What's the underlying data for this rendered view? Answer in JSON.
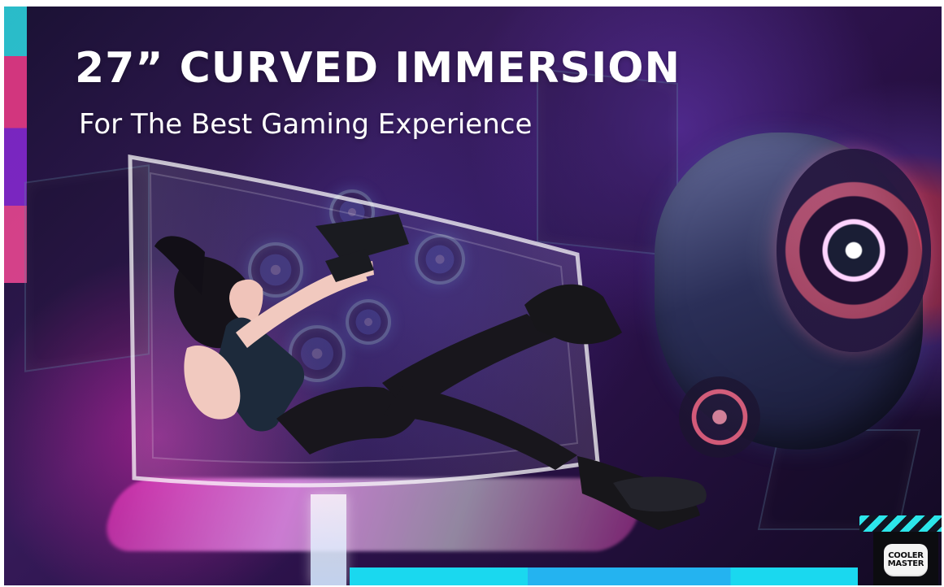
{
  "headline": "27” CURVED IMMERSION",
  "subheadline": "For The Best Gaming Experience",
  "brand": {
    "line1": "COOLER",
    "line2": "MASTER"
  },
  "colors": {
    "accent_cyan": "#2ce5ea",
    "accent_pink": "#ff3f8f",
    "accent_purple": "#8f2be0",
    "text_white": "#ffffff"
  }
}
